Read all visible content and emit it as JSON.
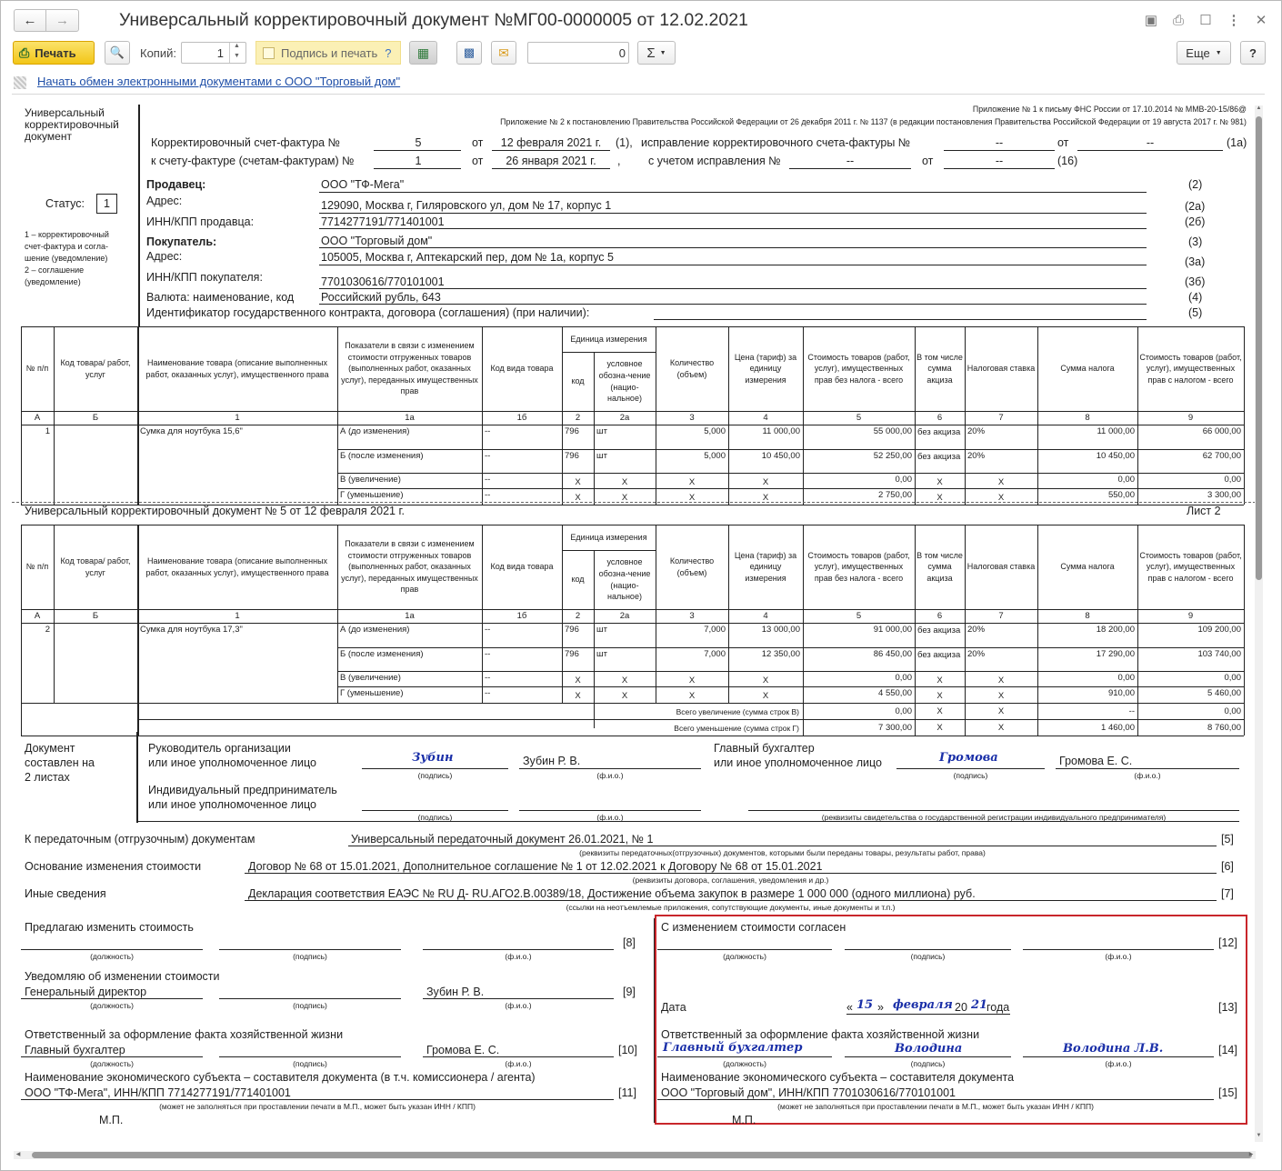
{
  "window": {
    "title": "Универсальный корректировочный документ №МГ00-0000005 от 12.02.2021"
  },
  "toolbar": {
    "print": "Печать",
    "copies_label": "Копий:",
    "copies_value": "1",
    "sign_print": "Подпись и печать",
    "sign_help": "?",
    "sum_value": "0",
    "sigma": "Σ",
    "more": "Еще",
    "help": "?"
  },
  "exchange_link": "Начать обмен электронными документами с ООО \"Торговый дом\"",
  "doc": {
    "app1": "Приложение № 1 к письму ФНС России от 17.10.2014 № ММВ-20-15/86@",
    "app2": "Приложение № 2 к постановлению Правительства Российской Федерации от 26 декабря 2011 г. № 1137 (в редакции постановления Правительства Российской Федерации от 19 августа 2017 г. № 981)",
    "left_title": "Универсальный\nкорректировочный\nдокумент",
    "status_label": "Статус:",
    "status_value": "1",
    "status_note": "1 – корректировочный\nсчет-фактура и согла-\nшение (уведомление)\n2 – соглашение\n(уведомление)",
    "h_row1_label": "Корректировочный счет-фактура №",
    "h_row1_no": "5",
    "h_ot": "от",
    "h_row1_date": "12 февраля 2021 г.",
    "h_row1_code": "(1),",
    "h_fix_label": "исправление корректировочного счета-фактуры №",
    "dash": "--",
    "h_fix_code": "(1а)",
    "h_row2_label": "к счету-фактуре (счетам-фактурам) №",
    "h_row2_no": "1",
    "h_row2_date": "26 января 2021 г.",
    "h_comma": ",",
    "h_row2_fix": "с учетом исправления №",
    "h_row2_code": "(16)",
    "seller_label": "Продавец:",
    "seller": "ООО \"ТФ-Мега\"",
    "seller_code": "(2)",
    "addr_label": "Адрес:",
    "seller_addr": "129090, Москва г, Гиляровского ул, дом № 17, корпус 1",
    "seller_addr_code": "(2а)",
    "seller_inn_label": "ИНН/КПП продавца:",
    "seller_inn": "7714277191/771401001",
    "seller_inn_code": "(2б)",
    "buyer_label": "Покупатель:",
    "buyer": "ООО \"Торговый дом\"",
    "buyer_code": "(3)",
    "buyer_addr": "105005, Москва г, Аптекарский пер, дом № 1а, корпус 5",
    "buyer_addr_code": "(3а)",
    "buyer_inn_label": "ИНН/КПП покупателя:",
    "buyer_inn": "7701030616/770101001",
    "buyer_inn_code": "(3б)",
    "currency_label": "Валюта: наименование, код",
    "currency": "Российский рубль, 643",
    "currency_code": "(4)",
    "contract_label": "Идентификатор государственного контракта, договора (соглашения) (при наличии):",
    "contract_code": "(5)",
    "sheet2_title": "Универсальный корректировочный документ № 5 от 12 февраля 2021 г.",
    "sheet2_label": "Лист 2"
  },
  "table_headers": [
    "№ п/п",
    "Код товара/ работ, услуг",
    "Наименование товара (описание выполненных работ, оказанных услуг), имущественного права",
    "Показатели в связи с изменением стоимости отгруженных товаров (выполненных работ, оказанных услуг), переданных имущественных прав",
    "Код вида товара",
    "Единица измерения",
    "код",
    "условное обозна-чение (нацио-нальное)",
    "Количество (объем)",
    "Цена (тариф) за единицу измерения",
    "Стоимость товаров (работ, услуг), имущественных прав без налога - всего",
    "В том числе сумма акциза",
    "Налоговая ставка",
    "Сумма налога",
    "Стоимость товаров (работ, услуг), имущественных прав с налогом - всего"
  ],
  "col_codes": [
    "А",
    "Б",
    "1",
    "1а",
    "1б",
    "2",
    "2а",
    "3",
    "4",
    "5",
    "6",
    "7",
    "8",
    "9"
  ],
  "table1": {
    "no": "1",
    "name": "Сумка для ноутбука 15,6\"",
    "rows": [
      [
        "А (до изменения)",
        "--",
        "796",
        "шт",
        "5,000",
        "11 000,00",
        "55 000,00",
        "без акциза",
        "20%",
        "11 000,00",
        "66 000,00"
      ],
      [
        "Б (после изменения)",
        "--",
        "796",
        "шт",
        "5,000",
        "10 450,00",
        "52 250,00",
        "без акциза",
        "20%",
        "10 450,00",
        "62 700,00"
      ],
      [
        "В (увеличение)",
        "--",
        "X",
        "X",
        "X",
        "X",
        "0,00",
        "X",
        "X",
        "0,00",
        "0,00"
      ],
      [
        "Г (уменьшение)",
        "--",
        "X",
        "X",
        "X",
        "X",
        "2 750,00",
        "X",
        "X",
        "550,00",
        "3 300,00"
      ]
    ]
  },
  "table2": {
    "no": "2",
    "name": "Сумка для ноутбука 17,3\"",
    "rows": [
      [
        "А (до изменения)",
        "--",
        "796",
        "шт",
        "7,000",
        "13 000,00",
        "91 000,00",
        "без акциза",
        "20%",
        "18 200,00",
        "109 200,00"
      ],
      [
        "Б (после изменения)",
        "--",
        "796",
        "шт",
        "7,000",
        "12 350,00",
        "86 450,00",
        "без акциза",
        "20%",
        "17 290,00",
        "103 740,00"
      ],
      [
        "В (увеличение)",
        "--",
        "X",
        "X",
        "X",
        "X",
        "0,00",
        "X",
        "X",
        "0,00",
        "0,00"
      ],
      [
        "Г (уменьшение)",
        "--",
        "X",
        "X",
        "X",
        "X",
        "4 550,00",
        "X",
        "X",
        "910,00",
        "5 460,00"
      ]
    ],
    "total_inc_label": "Всего увеличение (сумма строк В)",
    "total_inc": [
      "0,00",
      "X",
      "X",
      "--",
      "0,00"
    ],
    "total_dec_label": "Всего уменьшение (сумма строк Г)",
    "total_dec": [
      "7 300,00",
      "X",
      "X",
      "1 460,00",
      "8 760,00"
    ]
  },
  "sign": {
    "left": "Документ\nсоставлен на\n2 листах",
    "head": "Руководитель организации\nили иное уполномоченное лицо",
    "head_sign": "Зубин",
    "head_name": "Зубин Р. В.",
    "acc": "Главный бухгалтер\nили иное уполномоченное лицо",
    "acc_sign": "Громова",
    "acc_name": "Громова Е. С.",
    "ip": "Индивидуальный предприниматель\nили иное уполномоченное лицо",
    "cap_sign": "(подпись)",
    "cap_fio": "(ф.и.о.)",
    "cap_pos": "(должность)",
    "cap_ip": "(реквизиты свидетельства о государственной  регистрации индивидуального предпринимателя)"
  },
  "bottom": {
    "transfer_label": "К передаточным (отгрузочным) документам",
    "transfer": "Универсальный передаточный документ 26.01.2021, № 1",
    "transfer_code": "[5]",
    "transfer_cap": "(реквизиты передаточных(отгрузочных) документов, которыми были переданы товары, результаты работ, права)",
    "basis_label": "Основание изменения стоимости",
    "basis": "Договор № 68 от 15.01.2021, Дополнительное соглашение № 1 от 12.02.2021 к Договору № 68 от 15.01.2021",
    "basis_code": "[6]",
    "basis_cap": "(реквизиты договора, соглашения, уведомления и др.)",
    "other_label": "Иные сведения",
    "other": "Декларация соответствия ЕАЭС № RU Д- RU.АГО2.В.00389/18, Достижение объема закупок в размере 1 000 000 (одного миллиона) руб.",
    "other_code": "[7]",
    "other_cap": "(ссылки на неотъемлемые приложения, сопутствующие документы, иные документы и т.п.)",
    "propose": "Предлагаю изменить стоимость",
    "code8": "[8]",
    "notify": "Уведомляю об изменении стоимости",
    "notify_pos": "Генеральный директор",
    "notify_name": "Зубин Р. В.",
    "code9": "[9]",
    "resp": "Ответственный за оформление факта хозяйственной жизни",
    "resp_pos": "Главный бухгалтер",
    "resp_name": "Громова Е. С.",
    "code10": "[10]",
    "entity": "Наименование экономического субъекта – составителя документа (в т.ч. комиссионера / агента)",
    "entity_val": "ООО \"ТФ-Мега\", ИНН/КПП 7714277191/771401001",
    "code11": "[11]",
    "entity_cap": "(может не заполняться при проставлении печати в М.П., может быть указан ИНН / КПП)",
    "mp": "М.П.",
    "agree": "С изменением стоимости согласен",
    "code12": "[12]",
    "date_label": "Дата",
    "q1": "«",
    "day": "15",
    "q2": "»",
    "month": "февраля",
    "year_pre": "20",
    "year": "21",
    "year_suf": "года",
    "code13": "[13]",
    "resp2": "Ответственный за оформление факта хозяйственной жизни",
    "resp2_pos": "Главный бухгалтер",
    "resp2_sign": "Володина",
    "resp2_name": "Володина Л.В.",
    "code14": "[14]",
    "entity2": "Наименование экономического субъекта – составителя документа",
    "entity2_val": "ООО \"Торговый дом\", ИНН/КПП 7701030616/770101001",
    "code15": "[15]"
  },
  "colors": {
    "highlight_border": "#c8262b",
    "signature": "#1a2fa8",
    "print_button": "#f6cf2f",
    "link": "#1f4fa8"
  }
}
